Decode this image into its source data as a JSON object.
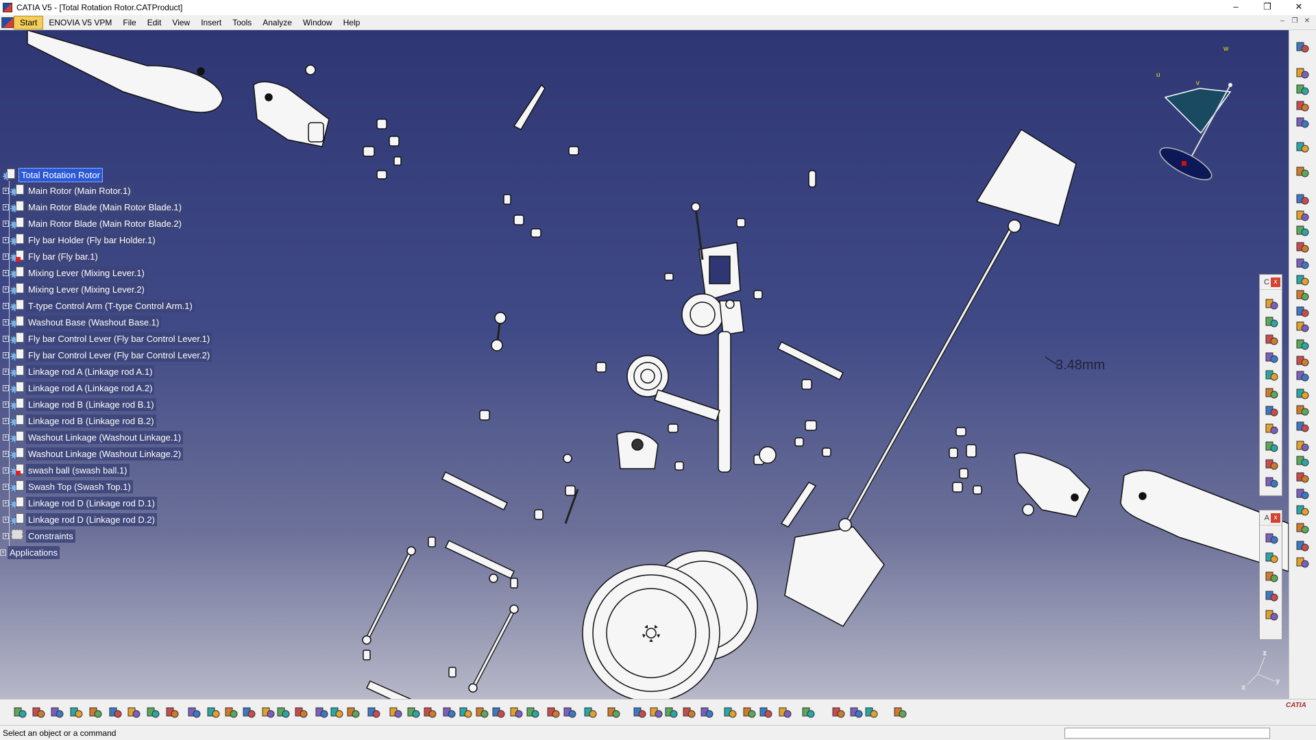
{
  "window": {
    "title": "CATIA V5 - [Total Rotation Rotor.CATProduct]",
    "minimize": "–",
    "restore": "❐",
    "close": "✕"
  },
  "menubar": {
    "items": [
      "Start",
      "ENOVIA V5 VPM",
      "File",
      "Edit",
      "View",
      "Insert",
      "Tools",
      "Analyze",
      "Window",
      "Help"
    ],
    "mdi_controls": [
      "–",
      "❐",
      "✕"
    ]
  },
  "tree": {
    "root": "Total Rotation Rotor",
    "items": [
      {
        "label": "Main Rotor (Main Rotor.1)",
        "flag": false
      },
      {
        "label": "Main Rotor Blade (Main Rotor Blade.1)",
        "flag": false
      },
      {
        "label": "Main Rotor Blade (Main Rotor Blade.2)",
        "flag": false
      },
      {
        "label": "Fly bar Holder (Fly bar Holder.1)",
        "flag": false
      },
      {
        "label": "Fly bar (Fly bar.1)",
        "flag": true
      },
      {
        "label": "Mixing Lever (Mixing Lever.1)",
        "flag": false
      },
      {
        "label": "Mixing Lever (Mixing Lever.2)",
        "flag": false
      },
      {
        "label": "T-type Control Arm (T-type Control Arm.1)",
        "flag": false
      },
      {
        "label": "Washout Base (Washout Base.1)",
        "flag": false
      },
      {
        "label": "Fly bar Control Lever (Fly bar Control Lever.1)",
        "flag": false
      },
      {
        "label": "Fly bar Control Lever (Fly bar Control Lever.2)",
        "flag": false
      },
      {
        "label": "Linkage rod A (Linkage rod A.1)",
        "flag": false
      },
      {
        "label": "Linkage rod A (Linkage rod A.2)",
        "flag": false
      },
      {
        "label": "Linkage rod B (Linkage rod B.1)",
        "flag": false
      },
      {
        "label": "Linkage rod B (Linkage rod B.2)",
        "flag": false
      },
      {
        "label": "Washout Linkage (Washout Linkage.1)",
        "flag": false
      },
      {
        "label": "Washout Linkage (Washout Linkage.2)",
        "flag": false
      },
      {
        "label": "swash ball (swash ball.1)",
        "flag": true
      },
      {
        "label": "Swash Top (Swash Top.1)",
        "flag": false
      },
      {
        "label": "Linkage rod D (Linkage rod D.1)",
        "flag": false
      },
      {
        "label": "Linkage rod D (Linkage rod D.2)",
        "flag": false
      }
    ],
    "constraints": "Constraints",
    "applications": "Applications"
  },
  "viewport": {
    "measurement": "3.48mm",
    "compass_labels": {
      "u": "u",
      "v": "v",
      "w": "w"
    },
    "axis_labels": {
      "x": "x",
      "y": "y",
      "z": "z"
    }
  },
  "floating_panels": [
    {
      "letter": "C",
      "close": "x"
    },
    {
      "letter": "A",
      "close": "x"
    }
  ],
  "statusbar": {
    "message": "Select an object or a command"
  },
  "logo": "CATIA",
  "colors": {
    "viewport_top": "#2e3773",
    "viewport_bottom": "#b7b8c8",
    "tree_selected": "#2a58d6",
    "menu_active": "#f5cd59"
  }
}
